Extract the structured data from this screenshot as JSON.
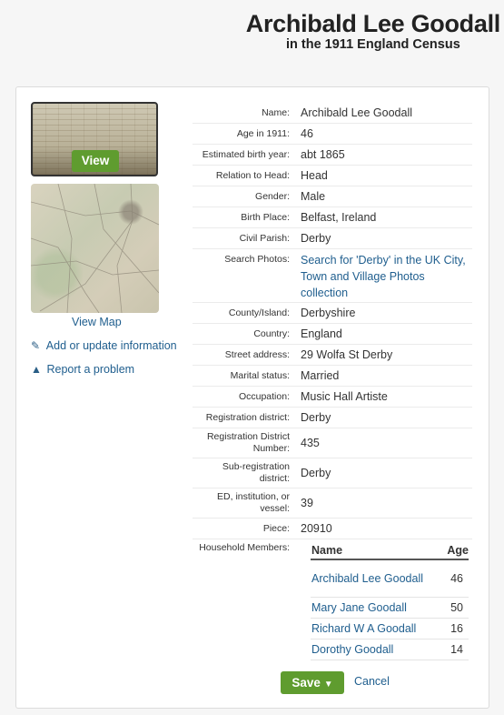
{
  "header": {
    "title": "Archibald Lee Goodall",
    "subtitle": "in the 1911 England Census"
  },
  "sidebar": {
    "view_button": "View",
    "view_map": "View Map",
    "add_update": "Add or update information",
    "report_problem": "Report a problem"
  },
  "record": [
    {
      "label": "Name:",
      "value": "Archibald Lee Goodall"
    },
    {
      "label": "Age in 1911:",
      "value": "46"
    },
    {
      "label": "Estimated birth year:",
      "value": "abt 1865"
    },
    {
      "label": "Relation to Head:",
      "value": "Head"
    },
    {
      "label": "Gender:",
      "value": "Male"
    },
    {
      "label": "Birth Place:",
      "value": "Belfast, Ireland"
    },
    {
      "label": "Civil Parish:",
      "value": "Derby"
    },
    {
      "label": "Search Photos:",
      "value": "Search for 'Derby' in the UK City, Town and Village Photos collection"
    },
    {
      "label": "County/Island:",
      "value": "Derbyshire"
    },
    {
      "label": "Country:",
      "value": "England"
    },
    {
      "label": "Street address:",
      "value": "29 Wolfa St Derby"
    },
    {
      "label": "Marital status:",
      "value": "Married"
    },
    {
      "label": "Occupation:",
      "value": "Music Hall Artiste"
    },
    {
      "label": "Registration district:",
      "value": "Derby"
    },
    {
      "label": "Registration District Number:",
      "value": "435"
    },
    {
      "label": "Sub-registration district:",
      "value": "Derby"
    },
    {
      "label": "ED, institution, or vessel:",
      "value": "39"
    },
    {
      "label": "Piece:",
      "value": "20910"
    },
    {
      "label": "Household Members:",
      "value": ""
    }
  ],
  "household": {
    "col_name": "Name",
    "col_age": "Age",
    "members": [
      {
        "name": "Archibald Lee Goodall",
        "age": "46"
      },
      {
        "name": "Mary Jane Goodall",
        "age": "50"
      },
      {
        "name": "Richard W A Goodall",
        "age": "16"
      },
      {
        "name": "Dorothy Goodall",
        "age": "14"
      }
    ]
  },
  "actions": {
    "save": "Save",
    "cancel": "Cancel"
  },
  "colors": {
    "accent_green": "#5f9c2f",
    "link_blue": "#1f5e8e"
  }
}
